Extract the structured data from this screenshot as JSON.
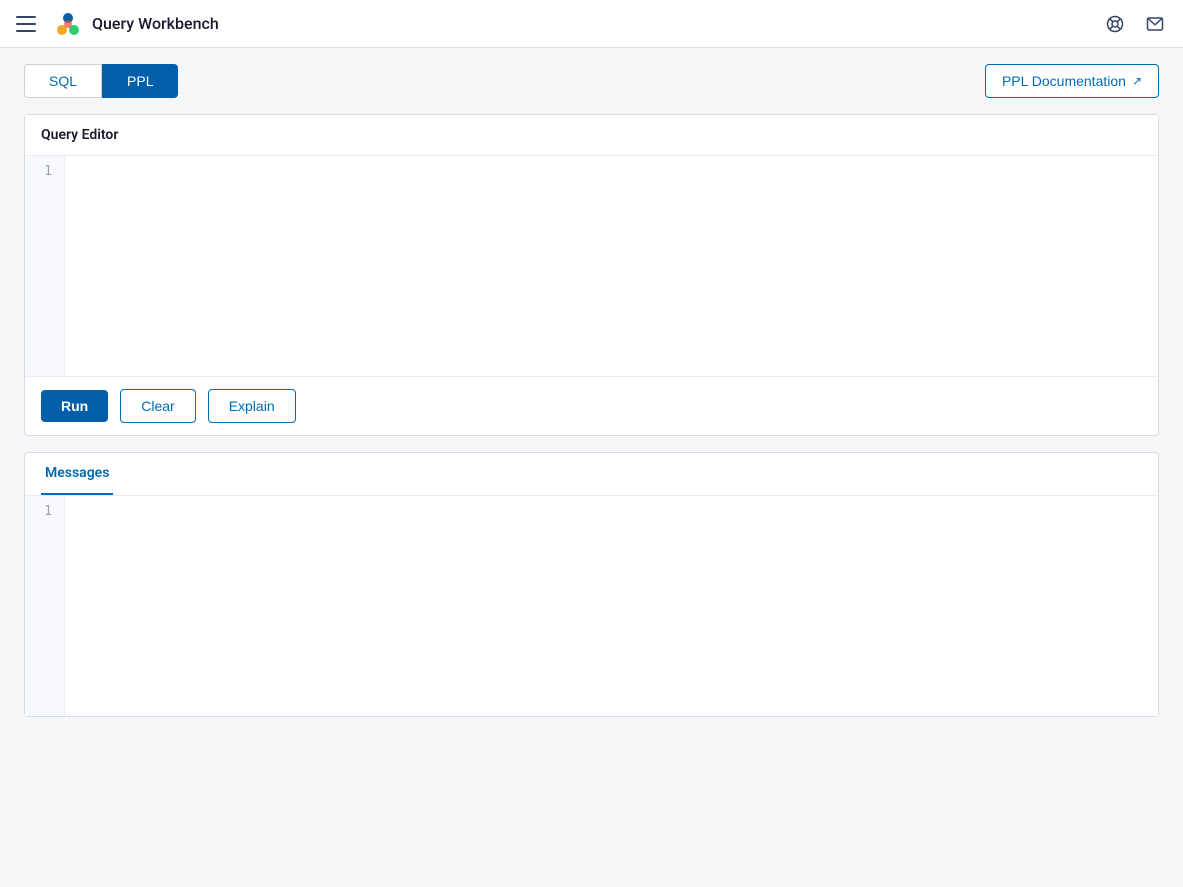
{
  "nav": {
    "title": "Query Workbench",
    "hamburger_label": "Menu",
    "help_icon": "help-icon",
    "mail_icon": "mail-icon"
  },
  "tabs": {
    "sql": {
      "label": "SQL",
      "active": false
    },
    "ppl": {
      "label": "PPL",
      "active": true
    }
  },
  "ppl_doc_button": {
    "label": "PPL Documentation",
    "external_icon": "↗"
  },
  "query_editor": {
    "title": "Query Editor",
    "line_numbers": [
      "1"
    ],
    "placeholder": ""
  },
  "actions": {
    "run_label": "Run",
    "clear_label": "Clear",
    "explain_label": "Explain"
  },
  "messages": {
    "tab_label": "Messages",
    "line_numbers": [
      "1"
    ],
    "content": ""
  }
}
